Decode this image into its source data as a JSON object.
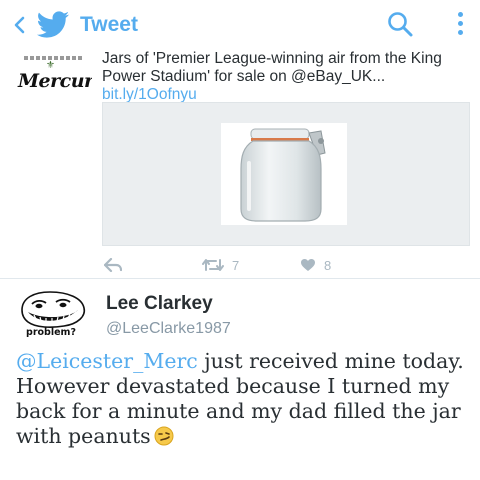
{
  "appbar": {
    "back_icon": "chevron-left-icon",
    "logo_icon": "twitter-bird-icon",
    "title": "Tweet",
    "search_icon": "search-icon",
    "more_icon": "more-vertical-icon",
    "accent_color": "#55acee"
  },
  "prev_tweet": {
    "avatar_text": "Mercury",
    "text": "Jars of 'Premier League-winning air from the King Power Stadium' for sale on @eBay_UK...",
    "link": "bit.ly/1Oofnyu",
    "media_icon": "glass-jar-image",
    "actions": {
      "reply_icon": "reply-icon",
      "retweet_icon": "retweet-icon",
      "retweet_count": "7",
      "like_icon": "heart-icon",
      "like_count": "8"
    }
  },
  "tweet": {
    "avatar_label": "problem?",
    "name": "Lee Clarkey",
    "handle": "@LeeClarke1987",
    "mention": "@Leicester_Merc",
    "text": " just received mine today. However devastated because I turned my back for a minute and my dad filled the jar with peanuts",
    "emoji_icon": "smirking-face-emoji"
  }
}
